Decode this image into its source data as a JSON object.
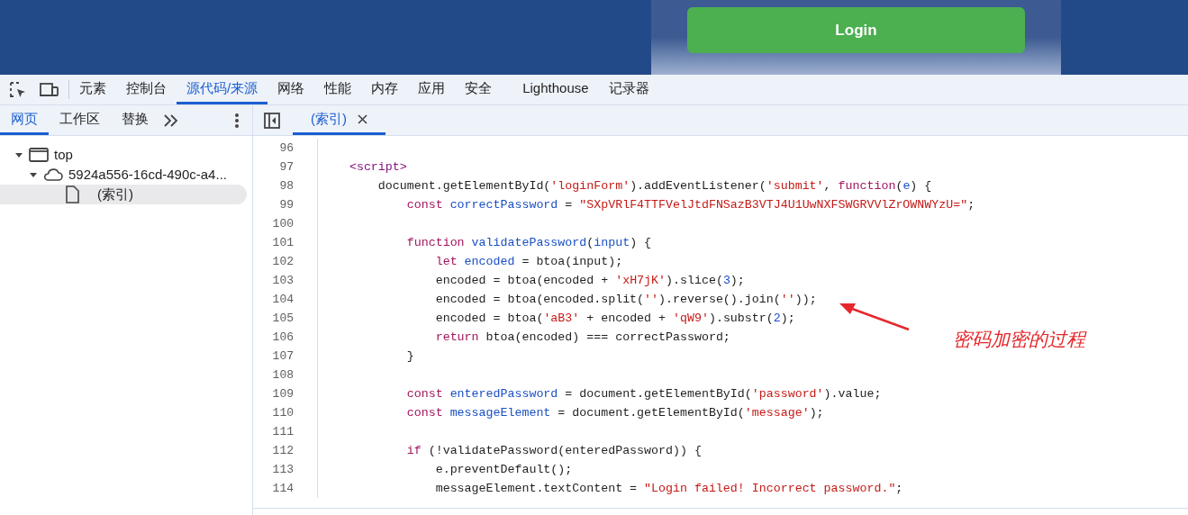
{
  "page_header": {
    "button": "Login"
  },
  "toolbar": {
    "tabs": [
      {
        "label": "元素",
        "selected": false
      },
      {
        "label": "控制台",
        "selected": false
      },
      {
        "label": "源代码/来源",
        "selected": true
      },
      {
        "label": "网络",
        "selected": false
      },
      {
        "label": "性能",
        "selected": false
      },
      {
        "label": "内存",
        "selected": false
      },
      {
        "label": "应用",
        "selected": false
      },
      {
        "label": "安全",
        "selected": false
      },
      {
        "label": "Lighthouse",
        "selected": false
      },
      {
        "label": "记录器",
        "selected": false
      }
    ]
  },
  "navigator": {
    "tabs": [
      {
        "label": "网页",
        "selected": true
      },
      {
        "label": "工作区",
        "selected": false
      },
      {
        "label": "替换",
        "selected": false
      }
    ],
    "tree": [
      {
        "label": "top",
        "kind": "frame",
        "expanded": true,
        "selected": false,
        "children": [
          {
            "label": "5924a556-16cd-490c-a4...",
            "kind": "origin",
            "expanded": true,
            "selected": false,
            "children": [
              {
                "label": "(索引)",
                "kind": "file",
                "selected": true
              }
            ]
          }
        ]
      }
    ]
  },
  "editor": {
    "tabs": [
      {
        "label": "(索引)",
        "selected": true
      }
    ],
    "lines": [
      {
        "number": "96"
      },
      {
        "number": "97",
        "tokens": [
          {
            "kind": "tag",
            "text": "    <script>"
          }
        ]
      },
      {
        "number": "98",
        "tokens": [
          {
            "kind": "plain",
            "text": "        document.getElementById("
          },
          {
            "kind": "string",
            "text": "'loginForm'"
          },
          {
            "kind": "plain",
            "text": ").addEventListener("
          },
          {
            "kind": "string",
            "text": "'submit'"
          },
          {
            "kind": "plain",
            "text": ", "
          },
          {
            "kind": "keyword",
            "text": "function"
          },
          {
            "kind": "plain",
            "text": "("
          },
          {
            "kind": "def",
            "text": "e"
          },
          {
            "kind": "plain",
            "text": ") {"
          }
        ]
      },
      {
        "number": "99",
        "tokens": [
          {
            "kind": "keyword",
            "text": "            const"
          },
          {
            "kind": "def",
            "text": " correctPassword"
          },
          {
            "kind": "plain",
            "text": " = "
          },
          {
            "kind": "string",
            "text": "\"SXpVRlF4TTFVelJtdFNSazB3VTJ4U1UwNXFSWGRVVlZrOWNWYzU=\""
          },
          {
            "kind": "plain",
            "text": ";"
          }
        ]
      },
      {
        "number": "100"
      },
      {
        "number": "101",
        "tokens": [
          {
            "kind": "keyword",
            "text": "            function"
          },
          {
            "kind": "def",
            "text": " validatePassword"
          },
          {
            "kind": "plain",
            "text": "("
          },
          {
            "kind": "def",
            "text": "input"
          },
          {
            "kind": "plain",
            "text": ") {"
          }
        ]
      },
      {
        "number": "102",
        "tokens": [
          {
            "kind": "keyword",
            "text": "                let"
          },
          {
            "kind": "def",
            "text": " encoded"
          },
          {
            "kind": "plain",
            "text": " = btoa(input);"
          }
        ]
      },
      {
        "number": "103",
        "tokens": [
          {
            "kind": "plain",
            "text": "                encoded = btoa(encoded + "
          },
          {
            "kind": "string",
            "text": "'xH7jK'"
          },
          {
            "kind": "plain",
            "text": ").slice("
          },
          {
            "kind": "number",
            "text": "3"
          },
          {
            "kind": "plain",
            "text": ");"
          }
        ]
      },
      {
        "number": "104",
        "tokens": [
          {
            "kind": "plain",
            "text": "                encoded = btoa(encoded.split("
          },
          {
            "kind": "string",
            "text": "''"
          },
          {
            "kind": "plain",
            "text": ").reverse().join("
          },
          {
            "kind": "string",
            "text": "''"
          },
          {
            "kind": "plain",
            "text": "));"
          }
        ]
      },
      {
        "number": "105",
        "tokens": [
          {
            "kind": "plain",
            "text": "                encoded = btoa("
          },
          {
            "kind": "string",
            "text": "'aB3'"
          },
          {
            "kind": "plain",
            "text": " + encoded + "
          },
          {
            "kind": "string",
            "text": "'qW9'"
          },
          {
            "kind": "plain",
            "text": ").substr("
          },
          {
            "kind": "number",
            "text": "2"
          },
          {
            "kind": "plain",
            "text": ");"
          }
        ]
      },
      {
        "number": "106",
        "tokens": [
          {
            "kind": "keyword",
            "text": "                return"
          },
          {
            "kind": "plain",
            "text": " btoa(encoded) === correctPassword;"
          }
        ]
      },
      {
        "number": "107",
        "tokens": [
          {
            "kind": "plain",
            "text": "            }"
          }
        ]
      },
      {
        "number": "108"
      },
      {
        "number": "109",
        "tokens": [
          {
            "kind": "keyword",
            "text": "            const"
          },
          {
            "kind": "def",
            "text": " enteredPassword"
          },
          {
            "kind": "plain",
            "text": " = document.getElementById("
          },
          {
            "kind": "string",
            "text": "'password'"
          },
          {
            "kind": "plain",
            "text": ").value;"
          }
        ]
      },
      {
        "number": "110",
        "tokens": [
          {
            "kind": "keyword",
            "text": "            const"
          },
          {
            "kind": "def",
            "text": " messageElement"
          },
          {
            "kind": "plain",
            "text": " = document.getElementById("
          },
          {
            "kind": "string",
            "text": "'message'"
          },
          {
            "kind": "plain",
            "text": ");"
          }
        ]
      },
      {
        "number": "111"
      },
      {
        "number": "112",
        "tokens": [
          {
            "kind": "keyword",
            "text": "            if"
          },
          {
            "kind": "plain",
            "text": " (!validatePassword(enteredPassword)) {"
          }
        ]
      },
      {
        "number": "113",
        "tokens": [
          {
            "kind": "plain",
            "text": "                e.preventDefault();"
          }
        ]
      },
      {
        "number": "114",
        "tokens": [
          {
            "kind": "plain",
            "text": "                messageElement.textContent = "
          },
          {
            "kind": "string",
            "text": "\"Login failed! Incorrect password.\""
          },
          {
            "kind": "plain",
            "text": ";"
          }
        ]
      }
    ]
  },
  "annotation": {
    "text": "密码加密的过程"
  }
}
